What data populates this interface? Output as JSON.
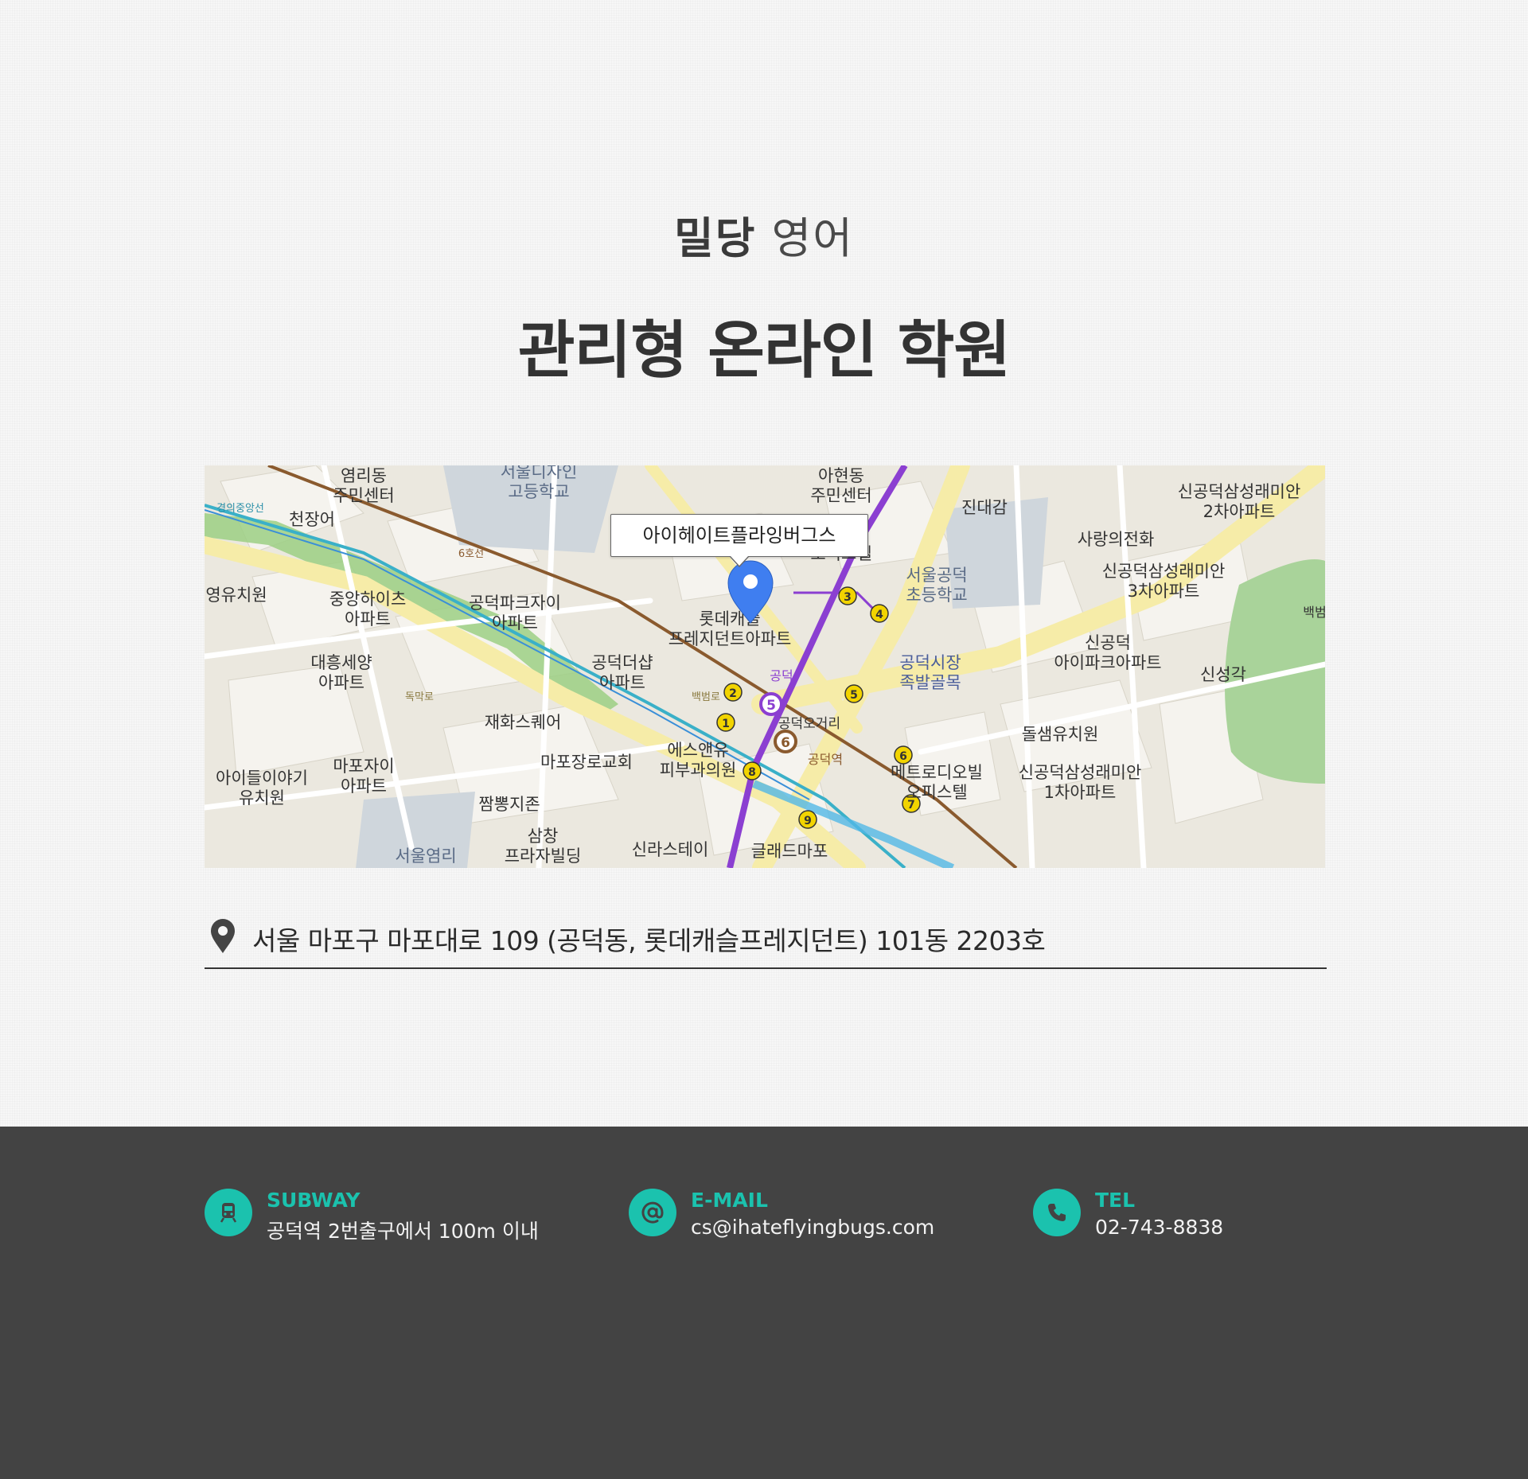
{
  "header": {
    "logo_part1": "밀당",
    "logo_part2": "영어",
    "headline": "관리형 온라인 학원"
  },
  "map": {
    "marker_label": "아이헤이트플라잉버그스",
    "labels": {
      "l1": "염리동",
      "l2": "주민센터",
      "l3": "서울디자인",
      "l4": "고등학교",
      "l5": "아현동",
      "l6": "주민센터",
      "l7": "진대감",
      "l8": "신공덕삼성래미안",
      "l9": "2차아파트",
      "l10": "천장어",
      "l11": "사랑의전화",
      "l12": "6호선",
      "l13": "오피스텔",
      "l14": "서울공덕",
      "l15": "초등학교",
      "l16": "신공덕삼성래미안",
      "l17": "3차아파트",
      "l18": "영유치원",
      "l19": "중앙하이츠",
      "l20": "아파트",
      "l21": "공덕파크자이",
      "l22": "아파트",
      "l23": "롯데캐슬",
      "l24": "프레지던트아파트",
      "l25": "신공덕",
      "l26": "아이파크아파트",
      "l27": "신성각",
      "l28": "대흥세양",
      "l29": "아파트",
      "l30": "공덕더샵",
      "l31": "아파트",
      "l32": "공덕시장",
      "l33": "족발골목",
      "l34": "재화스퀘어",
      "l35": "공덕오거리",
      "l36": "돌샘유치원",
      "l37": "마포장로교회",
      "l38": "에스앤유",
      "l39": "피부과의원",
      "l40": "메트로디오빌",
      "l41": "오피스텔",
      "l42": "마포자이",
      "l43": "아파트",
      "l44": "아이들이야기",
      "l45": "유치원",
      "l46": "신공덕삼성래미안",
      "l47": "1차아파트",
      "l48": "짬뽕지존",
      "l49": "삼창",
      "l50": "프라자빌딩",
      "l51": "신라스테이",
      "l52": "글래드마포",
      "l53": "서울염리",
      "l54": "백범",
      "l55": "공덕",
      "l56": "공덕역",
      "l57": "독막로",
      "l58": "백범로",
      "l59": "경의중앙선"
    },
    "exits": [
      "1",
      "2",
      "3",
      "4",
      "5",
      "6",
      "7",
      "8",
      "9"
    ],
    "line_numbers": [
      "5",
      "6"
    ],
    "colors": {
      "line5": "#8b3fd1",
      "line6": "#8a5a2e",
      "line_gyeongui": "#3ab0c8",
      "exit": "#f2d400",
      "marker": "#3f7ef0"
    }
  },
  "address": {
    "text": "서울 마포구 마포대로 109 (공덕동, 롯데캐슬프레지던트) 101동 2203호"
  },
  "footer": {
    "accent_color": "#1bc2ae",
    "subway": {
      "label": "SUBWAY",
      "value": "공덕역 2번출구에서 100m 이내",
      "icon": "train-icon"
    },
    "email": {
      "label": "E-MAIL",
      "value": "cs@ihateflyingbugs.com",
      "icon": "at-sign-icon"
    },
    "tel": {
      "label": "TEL",
      "value": "02-743-8838",
      "icon": "phone-icon"
    }
  }
}
